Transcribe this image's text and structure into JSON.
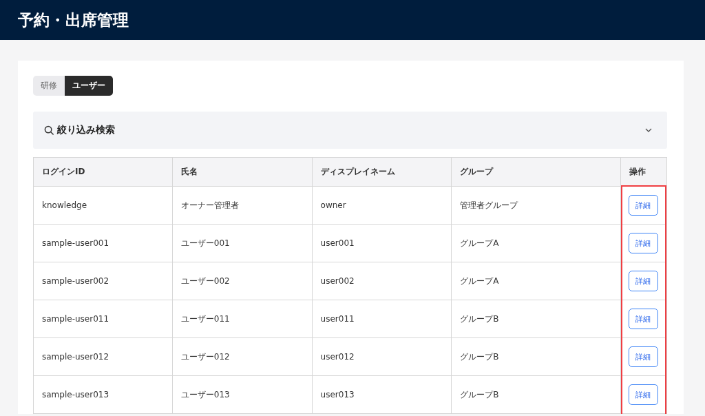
{
  "header": {
    "title": "予約・出席管理"
  },
  "tabs": [
    {
      "label": "研修",
      "selected": false
    },
    {
      "label": "ユーザー",
      "selected": true
    }
  ],
  "filter": {
    "label": "絞り込み検索",
    "expanded": false
  },
  "table": {
    "columns": [
      "ログインID",
      "氏名",
      "ディスプレイネーム",
      "グループ",
      "操作"
    ],
    "rows": [
      {
        "login_id": "knowledge",
        "name": "オーナー管理者",
        "display_name": "owner",
        "group": "管理者グループ",
        "action": "詳細"
      },
      {
        "login_id": "sample-user001",
        "name": "ユーザー001",
        "display_name": "user001",
        "group": "グループA",
        "action": "詳細"
      },
      {
        "login_id": "sample-user002",
        "name": "ユーザー002",
        "display_name": "user002",
        "group": "グループA",
        "action": "詳細"
      },
      {
        "login_id": "sample-user011",
        "name": "ユーザー011",
        "display_name": "user011",
        "group": "グループB",
        "action": "詳細"
      },
      {
        "login_id": "sample-user012",
        "name": "ユーザー012",
        "display_name": "user012",
        "group": "グループB",
        "action": "詳細"
      },
      {
        "login_id": "sample-user013",
        "name": "ユーザー013",
        "display_name": "user013",
        "group": "グループB",
        "action": "詳細"
      }
    ]
  },
  "highlight": {
    "on": true
  }
}
